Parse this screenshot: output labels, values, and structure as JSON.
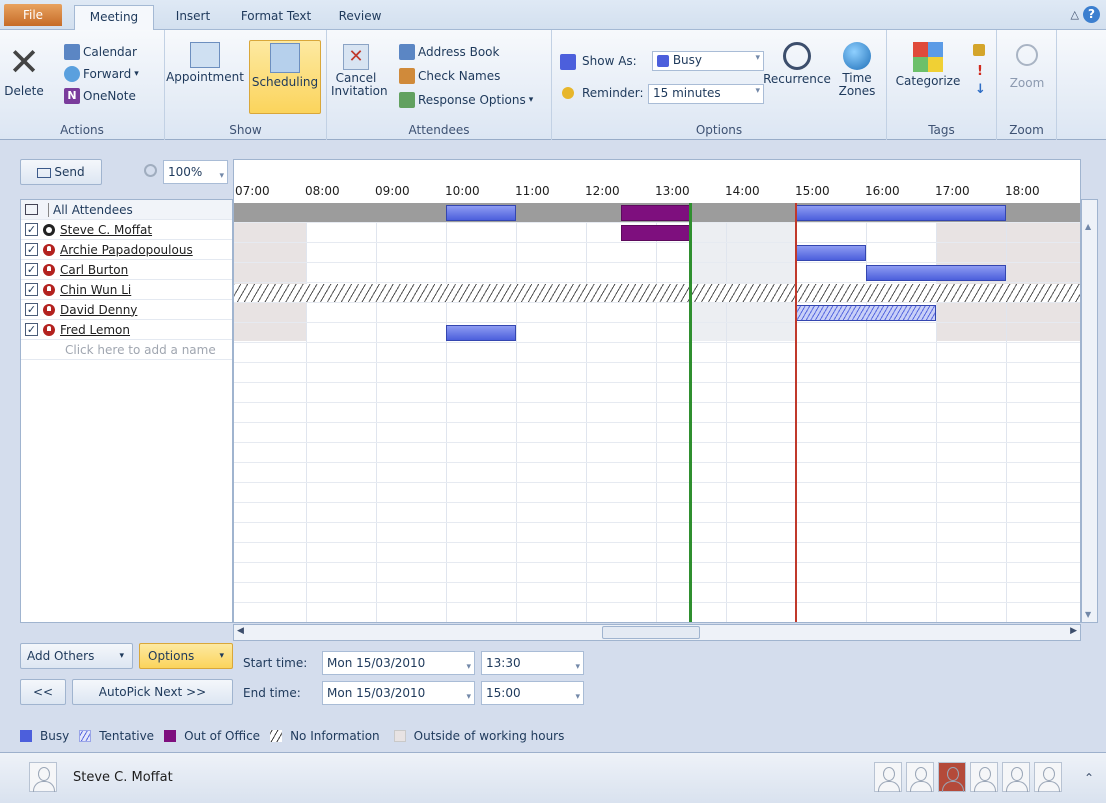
{
  "tabs": [
    "File",
    "Meeting",
    "Insert",
    "Format Text",
    "Review"
  ],
  "groups": {
    "actions": {
      "label": "Actions",
      "delete": "Delete",
      "calendar": "Calendar",
      "forward": "Forward",
      "onenote": "OneNote"
    },
    "show": {
      "label": "Show",
      "appointment": "Appointment",
      "scheduling": "Scheduling"
    },
    "attendees": {
      "label": "Attendees",
      "cancel1": "Cancel",
      "cancel2": "Invitation",
      "address_book": "Address Book",
      "check_names": "Check Names",
      "response_options": "Response Options"
    },
    "options": {
      "label": "Options",
      "show_as_label": "Show As:",
      "show_as_value": "Busy",
      "reminder_label": "Reminder:",
      "reminder_value": "15 minutes",
      "recurrence": "Recurrence",
      "time_zones1": "Time",
      "time_zones2": "Zones"
    },
    "tags": {
      "label": "Tags",
      "categorize": "Categorize"
    },
    "zoom": {
      "label": "Zoom",
      "zoom": "Zoom"
    }
  },
  "toolbar": {
    "send": "Send",
    "zoom_value": "100%"
  },
  "hours": [
    "07:00",
    "08:00",
    "09:00",
    "10:00",
    "11:00",
    "12:00",
    "13:00",
    "14:00",
    "15:00",
    "16:00",
    "17:00",
    "18:00"
  ],
  "attendees_header": "All Attendees",
  "attendees": [
    "Steve C. Moffat",
    "Archie Papadopoulous",
    "Carl Burton",
    "Chin Wun Li",
    "David Denny",
    "Fred Lemon"
  ],
  "add_name_placeholder": "Click here to add a name",
  "buttons": {
    "add_others": "Add Others",
    "options": "Options",
    "prev": "<<",
    "autopick": "AutoPick Next >>"
  },
  "times": {
    "start_label": "Start time:",
    "start_date": "Mon 15/03/2010",
    "start_time": "13:30",
    "end_label": "End time:",
    "end_date": "Mon 15/03/2010",
    "end_time": "15:00"
  },
  "legend": {
    "busy": "Busy",
    "tentative": "Tentative",
    "ooo": "Out of Office",
    "noinfo": "No Information",
    "outside": "Outside of working hours"
  },
  "people_pane": {
    "name": "Steve C. Moffat"
  },
  "colors": {
    "busy": "#4c5fdc",
    "ooo": "#7e0f7e",
    "start_line": "#2f8f2f",
    "end_line": "#c0392b"
  }
}
